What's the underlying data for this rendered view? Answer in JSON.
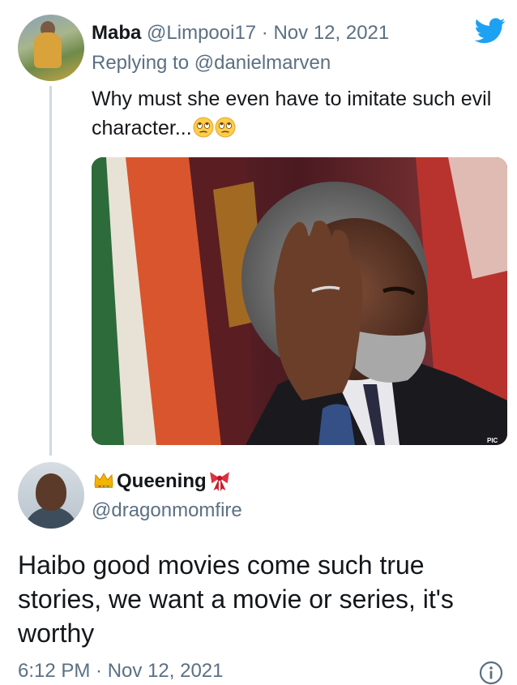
{
  "reply_tweet": {
    "display_name": "Maba",
    "handle": "@Limpooi17",
    "separator": " · ",
    "date": "Nov 12, 2021",
    "replying_label": "Replying to ",
    "replying_to": "@danielmarven",
    "text": "Why must she even have to imitate such evil character...",
    "emojis": [
      "face-with-rolling-eyes-icon",
      "face-with-rolling-eyes-icon"
    ],
    "media": {
      "type": "photo",
      "watermark": "PIC"
    }
  },
  "main_tweet": {
    "display_name": "Queening",
    "name_prefix_icon": "crown-icon",
    "name_suffix_icon": "ribbon-icon",
    "handle": "@dragonmomfire",
    "text": "Haibo good movies come such true stories, we want a movie or series, it's worthy",
    "time": "6:12 PM",
    "separator": " · ",
    "date": "Nov 12, 2021"
  },
  "icons": {
    "brand": "twitter-bird-icon",
    "info": "info-icon"
  },
  "colors": {
    "twitter_blue": "#1da1f2",
    "secondary_text": "#5b7083",
    "primary_text": "#14171a",
    "thread_line": "#cfd9de"
  }
}
